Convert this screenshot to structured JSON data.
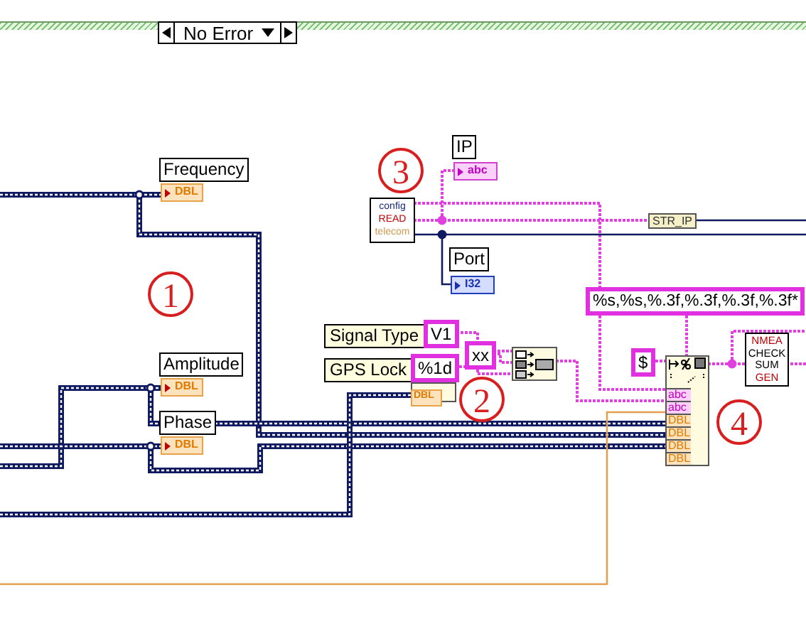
{
  "case_selector": {
    "label": "No Error"
  },
  "annotations": [
    "1",
    "2",
    "3",
    "4"
  ],
  "controls": [
    {
      "label": "Frequency",
      "terminal": "DBL"
    },
    {
      "label": "Amplitude",
      "terminal": "DBL"
    },
    {
      "label": "Phase",
      "terminal": "DBL"
    }
  ],
  "config_subvi": {
    "lines": [
      "config",
      "READ",
      "telecom"
    ]
  },
  "config_outputs": [
    {
      "label": "IP",
      "terminal": "abc"
    },
    {
      "label": "Port",
      "terminal": "I32"
    }
  ],
  "wire_label": "STR_IP",
  "format_constant": "%s,%s,%.3f,%.3f,%.3f,%.3f*",
  "labels": [
    "Signal Type",
    "GPS Lock"
  ],
  "string_constants": [
    "V1",
    "%1d",
    "xx",
    "$"
  ],
  "number_to_string": {
    "input": "DBL"
  },
  "format_node": {
    "inputs": [
      "abc",
      "abc",
      "DBL",
      "DBL",
      "DBL",
      "DBL"
    ]
  },
  "checksum_subvi": {
    "lines": [
      "NMEA",
      "CHECK",
      "SUM",
      "GEN"
    ]
  }
}
